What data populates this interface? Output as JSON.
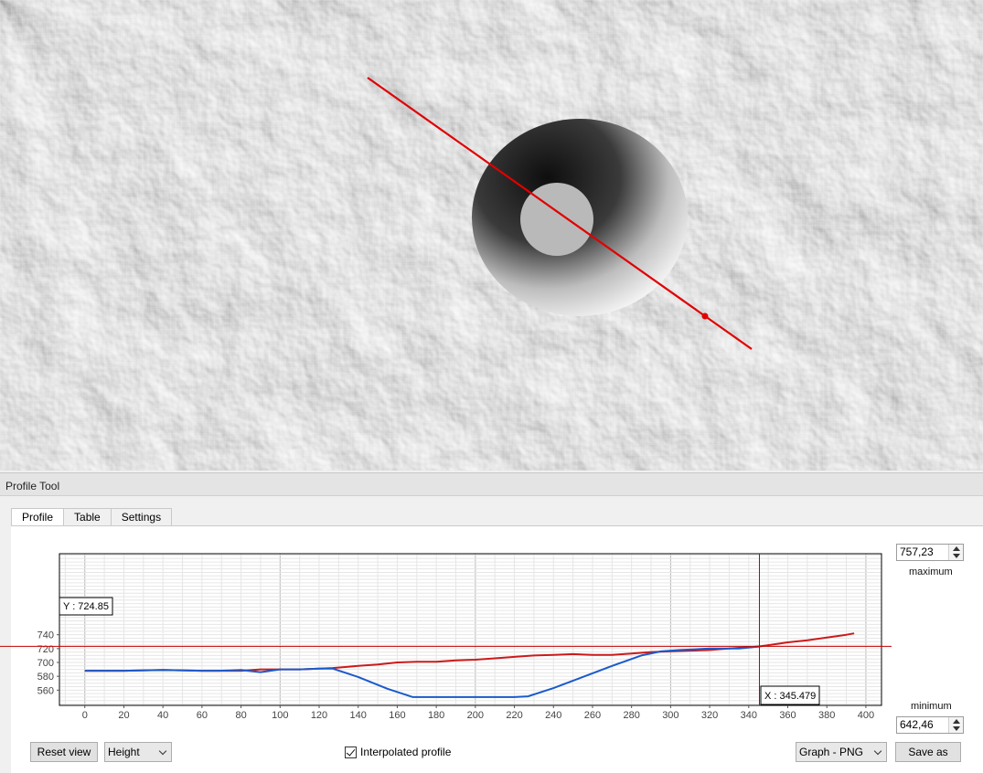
{
  "panel": {
    "title": "Profile Tool"
  },
  "tabs": [
    {
      "label": "Profile",
      "active": true
    },
    {
      "label": "Table",
      "active": false
    },
    {
      "label": "Settings",
      "active": false
    }
  ],
  "plot": {
    "y_readout": "Y : 724.85",
    "x_readout": "X : 345.479"
  },
  "chart_data": {
    "type": "line",
    "xlim": [
      -13,
      408
    ],
    "ylim": [
      538,
      757
    ],
    "x_ticks": [
      0,
      20,
      40,
      60,
      80,
      100,
      120,
      140,
      160,
      180,
      200,
      220,
      240,
      260,
      280,
      300,
      320,
      340,
      360,
      380,
      400
    ],
    "y_ticks": [
      {
        "value": 560,
        "label": "560"
      },
      {
        "value": 580,
        "label": "580"
      },
      {
        "value": 600,
        "label": "700"
      },
      {
        "value": 620,
        "label": "720"
      },
      {
        "value": 640,
        "label": "740"
      }
    ],
    "cursor": {
      "x": 345.479,
      "y": 724.85
    },
    "series": [
      {
        "color": "#cc1a1a",
        "x": [
          0,
          20,
          40,
          60,
          80,
          90,
          100,
          110,
          120,
          127,
          140,
          150,
          160,
          170,
          180,
          190,
          200,
          210,
          220,
          230,
          240,
          250,
          260,
          270,
          280,
          290,
          300,
          310,
          320,
          330,
          340,
          345,
          350,
          360,
          370,
          380,
          390,
          394
        ],
        "y": [
          588,
          588,
          589,
          588,
          588,
          590,
          590,
          590,
          591,
          592,
          595,
          597,
          600,
          601,
          601,
          603,
          604,
          606,
          608,
          610,
          611,
          612,
          611,
          611,
          613,
          615,
          616,
          617,
          618,
          620,
          622,
          623,
          625,
          629,
          632,
          636,
          640,
          642
        ]
      },
      {
        "color": "#1a5acc",
        "x": [
          0,
          20,
          40,
          60,
          68,
          80,
          90,
          100,
          110,
          120,
          127,
          140,
          155,
          168,
          180,
          200,
          220,
          227,
          240,
          255,
          270,
          285,
          295,
          305,
          320,
          335,
          345
        ],
        "y": [
          588,
          588,
          589,
          588,
          588,
          589,
          586,
          590,
          590,
          591,
          591,
          579,
          562,
          550,
          550,
          550,
          550,
          551,
          563,
          579,
          595,
          610,
          616,
          618,
          620,
          620,
          623
        ]
      }
    ]
  },
  "max_field": {
    "value": "757,23",
    "label": "maximum"
  },
  "min_field": {
    "value": "642,46",
    "label": "minimum"
  },
  "controls": {
    "reset_label": "Reset view",
    "mode_label": "Height",
    "interpolated_label": "Interpolated profile",
    "export_label": "Graph - PNG",
    "save_label": "Save as"
  }
}
